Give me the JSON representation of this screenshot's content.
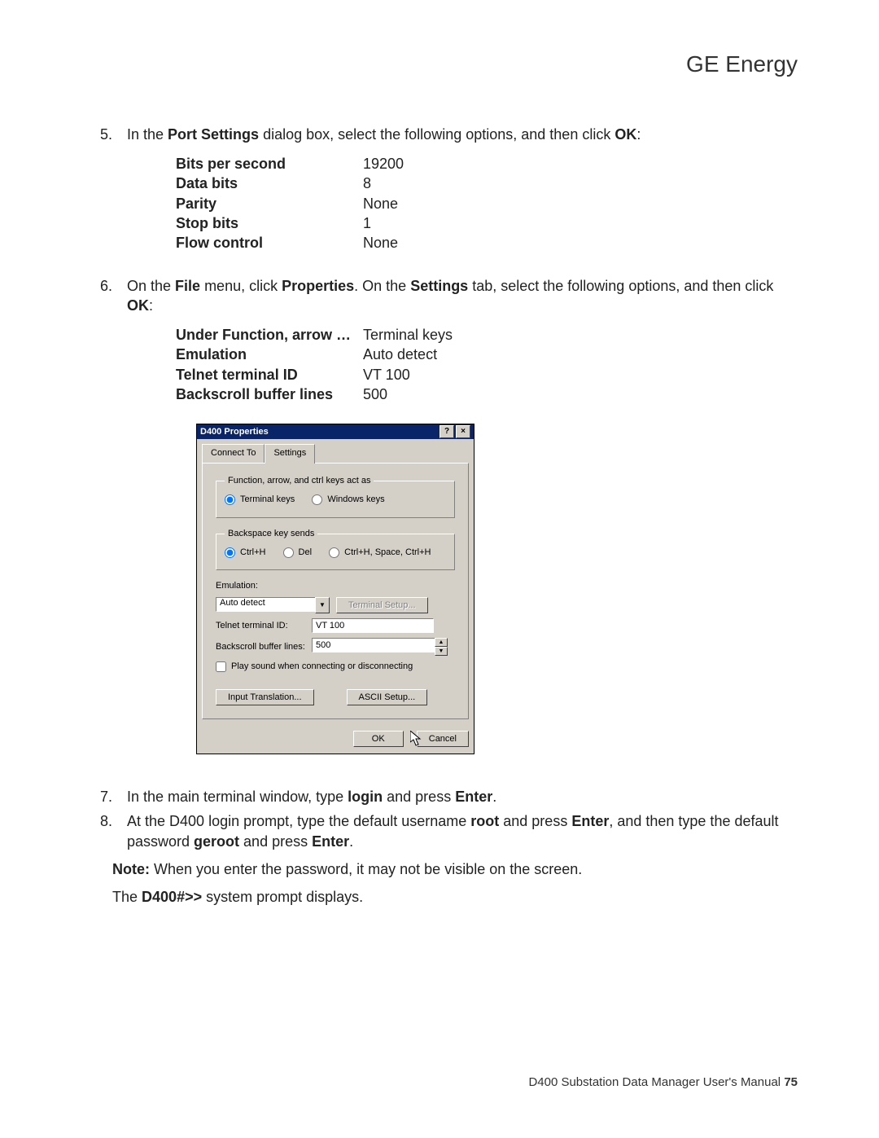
{
  "brand": "GE Energy",
  "step5": {
    "num": "5.",
    "pre": "In the ",
    "b1": "Port Settings",
    "mid": " dialog box, select the following options, and then click ",
    "b2": "OK",
    "post": ":",
    "table": [
      {
        "k": "Bits per second",
        "v": "19200"
      },
      {
        "k": "Data bits",
        "v": "8"
      },
      {
        "k": "Parity",
        "v": "None"
      },
      {
        "k": "Stop bits",
        "v": "1"
      },
      {
        "k": "Flow control",
        "v": "None"
      }
    ]
  },
  "step6": {
    "num": "6.",
    "pre": "On the ",
    "b1": "File",
    "mid1": " menu, click ",
    "b2": "Properties",
    "mid2": ". On the ",
    "b3": "Settings",
    "mid3": " tab, select the following options, and then click ",
    "b4": "OK",
    "post": ":",
    "table": [
      {
        "k": "Under Function, arrow …",
        "v": "Terminal keys"
      },
      {
        "k": "Emulation",
        "v": "Auto detect"
      },
      {
        "k": "Telnet terminal ID",
        "v": "VT 100"
      },
      {
        "k": "Backscroll buffer lines",
        "v": "500"
      }
    ]
  },
  "dialog": {
    "title": "D400 Properties",
    "help_btn": "?",
    "close_btn": "×",
    "tabs": {
      "connect": "Connect To",
      "settings": "Settings"
    },
    "grp_func": {
      "legend": "Function, arrow, and ctrl keys act as",
      "opt_terminal": "Terminal keys",
      "opt_windows": "Windows keys"
    },
    "grp_back": {
      "legend": "Backspace key sends",
      "opt_ctrlh": "Ctrl+H",
      "opt_del": "Del",
      "opt_combo": "Ctrl+H, Space, Ctrl+H"
    },
    "emulation_label": "Emulation:",
    "emulation_value": "Auto detect",
    "terminal_setup_btn": "Terminal Setup...",
    "telnet_label": "Telnet terminal ID:",
    "telnet_value": "VT 100",
    "backscroll_label": "Backscroll buffer lines:",
    "backscroll_value": "500",
    "sound_checkbox": "Play sound when connecting or disconnecting",
    "input_trans_btn": "Input Translation...",
    "ascii_btn": "ASCII Setup...",
    "ok": "OK",
    "cancel": "Cancel"
  },
  "step7": {
    "num": "7.",
    "pre": "In the main terminal window, type ",
    "b1": "login",
    "mid": " and press ",
    "b2": "Enter",
    "post": "."
  },
  "step8": {
    "num": "8.",
    "pre": "At the D400 login prompt, type the default username ",
    "b1": "root",
    "mid1": " and press ",
    "b2": "Enter",
    "mid2": ", and then type the default password ",
    "b3": "geroot",
    "mid3": " and press ",
    "b4": "Enter",
    "post": "."
  },
  "note": {
    "b": "Note:",
    "t": "  When you enter the password, it may not be visible on the screen."
  },
  "tail": {
    "pre": "The ",
    "b": "D400#>>",
    "post": " system prompt displays."
  },
  "footer": {
    "t": "D400 Substation Data Manager User's Manual  ",
    "p": "75"
  }
}
